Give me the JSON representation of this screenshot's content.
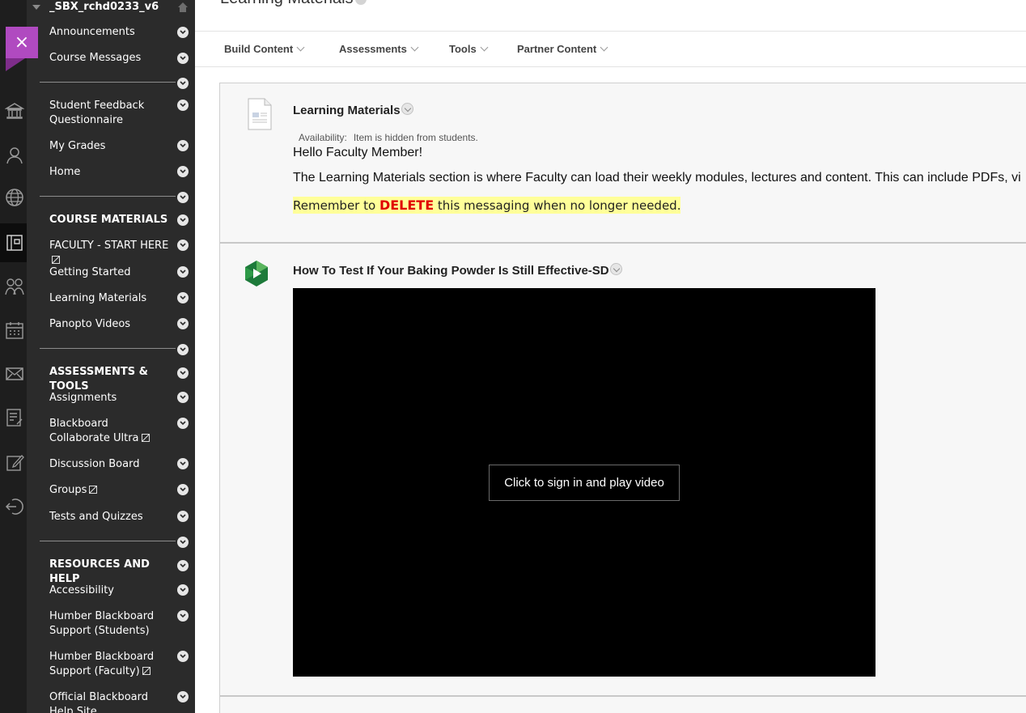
{
  "course_menu": {
    "course_id": "_SBX_rchd0233_v6",
    "close_label": "×",
    "groups": [
      {
        "heading": "",
        "items": [
          "Announcements",
          "Course Messages"
        ]
      },
      {
        "heading": "",
        "items": [
          "Student Feedback Questionnaire",
          "My Grades",
          "Home"
        ]
      },
      {
        "heading": "COURSE MATERIALS",
        "items": [
          "FACULTY - START HERE",
          "Getting Started",
          "Learning Materials",
          "Panopto Videos"
        ]
      },
      {
        "heading": "ASSESSMENTS & TOOLS",
        "items": [
          "Assignments",
          "Blackboard Collaborate Ultra",
          "Discussion Board",
          "Groups",
          "Tests and Quizzes"
        ]
      },
      {
        "heading": "RESOURCES AND HELP",
        "items": [
          "Accessibility",
          "Humber Blackboard Support (Students)",
          "Humber Blackboard Support (Faculty)",
          "Official Blackboard Help Site"
        ]
      }
    ]
  },
  "page": {
    "title": "Learning Materials"
  },
  "action_bar": {
    "items": [
      "Build Content",
      "Assessments",
      "Tools",
      "Partner Content"
    ]
  },
  "content_items": [
    {
      "title": "Learning Materials",
      "availability_label": "Availability:",
      "availability_value": "Item is hidden from students.",
      "greeting": "Hello Faculty Member!",
      "description": "The Learning Materials section is where Faculty can load their weekly modules, lectures and content.  This can include PDFs, vi",
      "reminder_pre": "Remember to ",
      "reminder_emph": "DELETE",
      "reminder_post": " this messaging when no longer needed."
    },
    {
      "title": "How To Test If Your Baking Powder Is Still Effective-SD",
      "video_button": "Click to sign in and play video"
    }
  ]
}
